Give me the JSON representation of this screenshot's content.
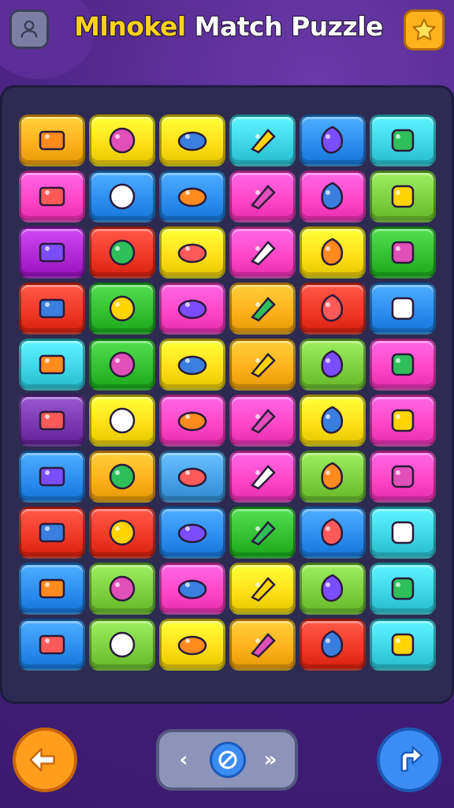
{
  "header": {
    "title_word1": "Mlnokel",
    "title_word2": "Match Puzzle",
    "profile_icon": "user-icon",
    "star_icon": "star-icon"
  },
  "colors": {
    "title_yellow": "#ffd21a",
    "back_orange": "#ff9d1c",
    "redo_blue": "#3b8df3"
  },
  "board": {
    "rows": 10,
    "cols": 6,
    "tiles": [
      {
        "color": "#ffb21d",
        "icon": "box-icon"
      },
      {
        "color": "#ffe11a",
        "icon": "calendar-icon"
      },
      {
        "color": "#ffe11a",
        "icon": "leaf-icon"
      },
      {
        "color": "#3fd7e8",
        "icon": "lemon-icon"
      },
      {
        "color": "#2f8ff0",
        "icon": "flower-icon"
      },
      {
        "color": "#3fd7e8",
        "icon": "play-icon"
      },
      {
        "color": "#ff48c8",
        "icon": "plum-icon"
      },
      {
        "color": "#2f8ff0",
        "icon": "snake-icon"
      },
      {
        "color": "#2f8ff0",
        "icon": "rolling-pin-icon"
      },
      {
        "color": "#ff48c8",
        "icon": "gear-icon"
      },
      {
        "color": "#ff48c8",
        "icon": "cheese-icon"
      },
      {
        "color": "#7fd142",
        "icon": "cube-icon"
      },
      {
        "color": "#b12ad6",
        "icon": "ring-icon"
      },
      {
        "color": "#f03a2a",
        "icon": "cookie-icon"
      },
      {
        "color": "#ffe11a",
        "icon": "phone-icon"
      },
      {
        "color": "#ff48c8",
        "icon": "kite-icon"
      },
      {
        "color": "#ffe11a",
        "icon": "pencil-icon"
      },
      {
        "color": "#34c234",
        "icon": "marker-icon"
      },
      {
        "color": "#f03a2a",
        "icon": "butter-icon"
      },
      {
        "color": "#34c234",
        "icon": "glue-icon"
      },
      {
        "color": "#ff48c8",
        "icon": "fish-icon"
      },
      {
        "color": "#ffb21d",
        "icon": "book-icon"
      },
      {
        "color": "#f03a2a",
        "icon": "monster-icon"
      },
      {
        "color": "#2f8ff0",
        "icon": "butter-icon"
      },
      {
        "color": "#3fd7e8",
        "icon": "mango-icon"
      },
      {
        "color": "#34c234",
        "icon": "pea-pod-icon"
      },
      {
        "color": "#ffe11a",
        "icon": "car-icon"
      },
      {
        "color": "#ffb21d",
        "icon": "popsicle-icon"
      },
      {
        "color": "#7fd142",
        "icon": "berry-icon"
      },
      {
        "color": "#ff48c8",
        "icon": "envelope-icon"
      },
      {
        "color": "#7a3ab0",
        "icon": "roll-icon"
      },
      {
        "color": "#ffe11a",
        "icon": "ball-icon"
      },
      {
        "color": "#ff48c8",
        "icon": "can-icon"
      },
      {
        "color": "#ff48c8",
        "icon": "sun-icon"
      },
      {
        "color": "#ffe11a",
        "icon": "palette-icon"
      },
      {
        "color": "#ff48c8",
        "icon": "tape-icon"
      },
      {
        "color": "#2f8ff0",
        "icon": "eye-icon"
      },
      {
        "color": "#ffb21d",
        "icon": "yarn-icon"
      },
      {
        "color": "#4aa3e8",
        "icon": "crayon-icon"
      },
      {
        "color": "#ff48c8",
        "icon": "chick-icon"
      },
      {
        "color": "#7fd142",
        "icon": "dish-icon"
      },
      {
        "color": "#ff48c8",
        "icon": "pencil-icon"
      },
      {
        "color": "#f03a2a",
        "icon": "jar-icon"
      },
      {
        "color": "#f03a2a",
        "icon": "tomato-icon"
      },
      {
        "color": "#2f8ff0",
        "icon": "bubble-icon"
      },
      {
        "color": "#34c234",
        "icon": "pear-icon"
      },
      {
        "color": "#2f8ff0",
        "icon": "bean-icon"
      },
      {
        "color": "#3fd7e8",
        "icon": "crate-icon"
      },
      {
        "color": "#2f8ff0",
        "icon": "lens-icon"
      },
      {
        "color": "#7fd142",
        "icon": "battery-icon"
      },
      {
        "color": "#ff48c8",
        "icon": "bear-icon"
      },
      {
        "color": "#ffe11a",
        "icon": "donut-icon"
      },
      {
        "color": "#7fd142",
        "icon": "printer-icon"
      },
      {
        "color": "#3fd7e8",
        "icon": "strawberry-icon"
      },
      {
        "color": "#2f8ff0",
        "icon": "carrot-icon"
      },
      {
        "color": "#7fd142",
        "icon": "slime-icon"
      },
      {
        "color": "#ffe11a",
        "icon": "bag-icon"
      },
      {
        "color": "#ffb21d",
        "icon": "chocolate-icon"
      },
      {
        "color": "#f03a2a",
        "icon": "capsule-icon"
      },
      {
        "color": "#3fd7e8",
        "icon": "apple-icon"
      }
    ]
  },
  "footer": {
    "back_icon": "undo-arrow-icon",
    "redo_icon": "redo-arrow-icon",
    "prev_icon": "chevron-left-icon",
    "next_icon": "double-chevron-right-icon",
    "center_icon": "ban-icon"
  }
}
